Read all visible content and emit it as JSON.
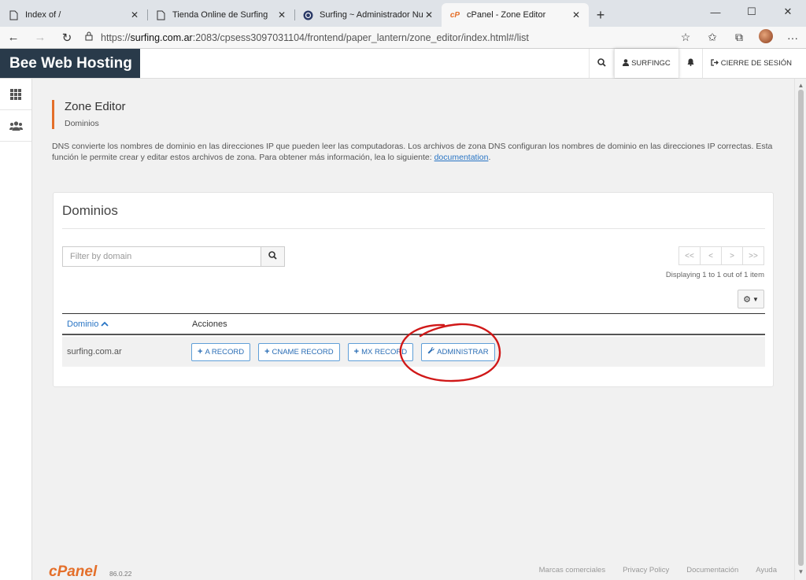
{
  "browser": {
    "tabs": [
      {
        "title": "Index of /",
        "icon": "page-icon"
      },
      {
        "title": "Tienda Online de Surfing",
        "icon": "page-icon"
      },
      {
        "title": "Surfing ~ Administrador Nube ~",
        "icon": "globe-icon"
      },
      {
        "title": "cPanel - Zone Editor",
        "icon": "cpanel-icon",
        "active": true
      }
    ],
    "url_prefix": "https://",
    "url_host": "surfing.com.ar",
    "url_rest": ":2083/cpsess3097031104/frontend/paper_lantern/zone_editor/index.html#/list"
  },
  "header": {
    "brand": "Bee Web Hosting",
    "user": "SURFINGC",
    "logout": "CIERRE DE SESIÓN"
  },
  "page": {
    "title": "Zone Editor",
    "subtitle": "Dominios",
    "description": "DNS convierte los nombres de dominio en las direcciones IP que pueden leer las computadoras. Los archivos de zona DNS configuran los nombres de dominio en las direcciones IP correctas. Esta función le permite crear y editar estos archivos de zona. Para obtener más información, lea lo siguiente: ",
    "doc_link": "documentation",
    "desc_end": "."
  },
  "panel": {
    "title": "Dominios",
    "search_placeholder": "Filter by domain",
    "pager": {
      "first": "<<",
      "prev": "<",
      "next": ">",
      "last": ">>"
    },
    "pager_info": "Displaying 1 to 1 out of 1 item",
    "col_domain": "Dominio",
    "col_actions": "Acciones",
    "rows": [
      {
        "domain": "surfing.com.ar",
        "actions": [
          "A RECORD",
          "CNAME RECORD",
          "MX RECORD",
          "ADMINISTRAR"
        ]
      }
    ]
  },
  "footer": {
    "logo": "cPanel",
    "version": "86.0.22",
    "links": [
      "Marcas comerciales",
      "Privacy Policy",
      "Documentación",
      "Ayuda"
    ]
  },
  "colors": {
    "brand_bg": "#293a4a",
    "accent": "#e46f2a",
    "link": "#2874c4",
    "annotation": "#d01818"
  }
}
